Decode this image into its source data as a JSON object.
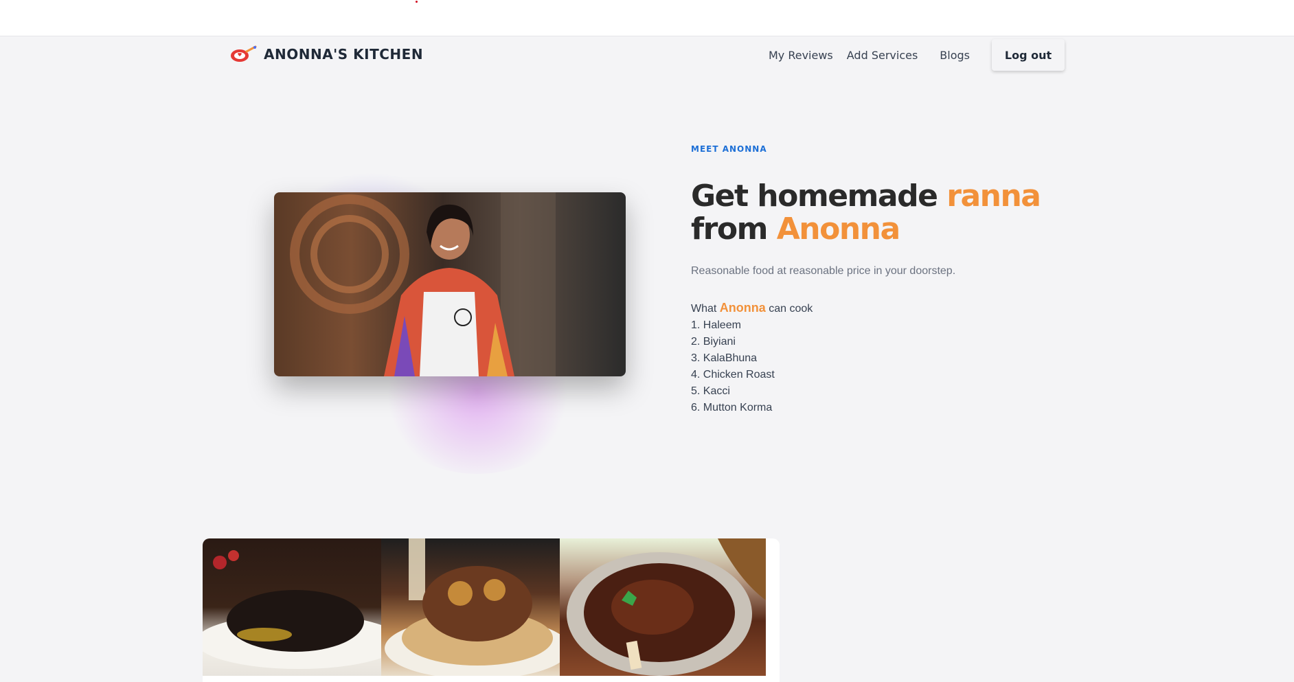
{
  "brand": {
    "name": "ANONNA'S KITCHEN",
    "logo_icon": "frying-pan-heart-icon",
    "accent_color": "#f2913a"
  },
  "nav": {
    "links": [
      "My Reviews",
      "Add Services",
      "Blogs"
    ],
    "logout_label": "Log out"
  },
  "hero": {
    "eyebrow": "MEET ANONNA",
    "headline": {
      "part1": "Get homemade ",
      "highlight1": "ranna",
      "part2": "from ",
      "highlight2": "Anonna"
    },
    "subtitle": "Reasonable food at reasonable price in your doorstep.",
    "cook_intro": {
      "prefix": "What ",
      "name": "Anonna",
      "suffix": " can cook"
    },
    "dishes": [
      "1. Haleem",
      "2. Biyiani",
      "3. KalaBhuna",
      "4. Chicken Roast",
      "5. Kacci",
      "6. Mutton Korma"
    ],
    "photo_icon": "chef-portrait-photo"
  },
  "gallery": {
    "photos": [
      "kala-bhuna-photo",
      "biryani-photo",
      "mutton-curry-photo"
    ]
  }
}
